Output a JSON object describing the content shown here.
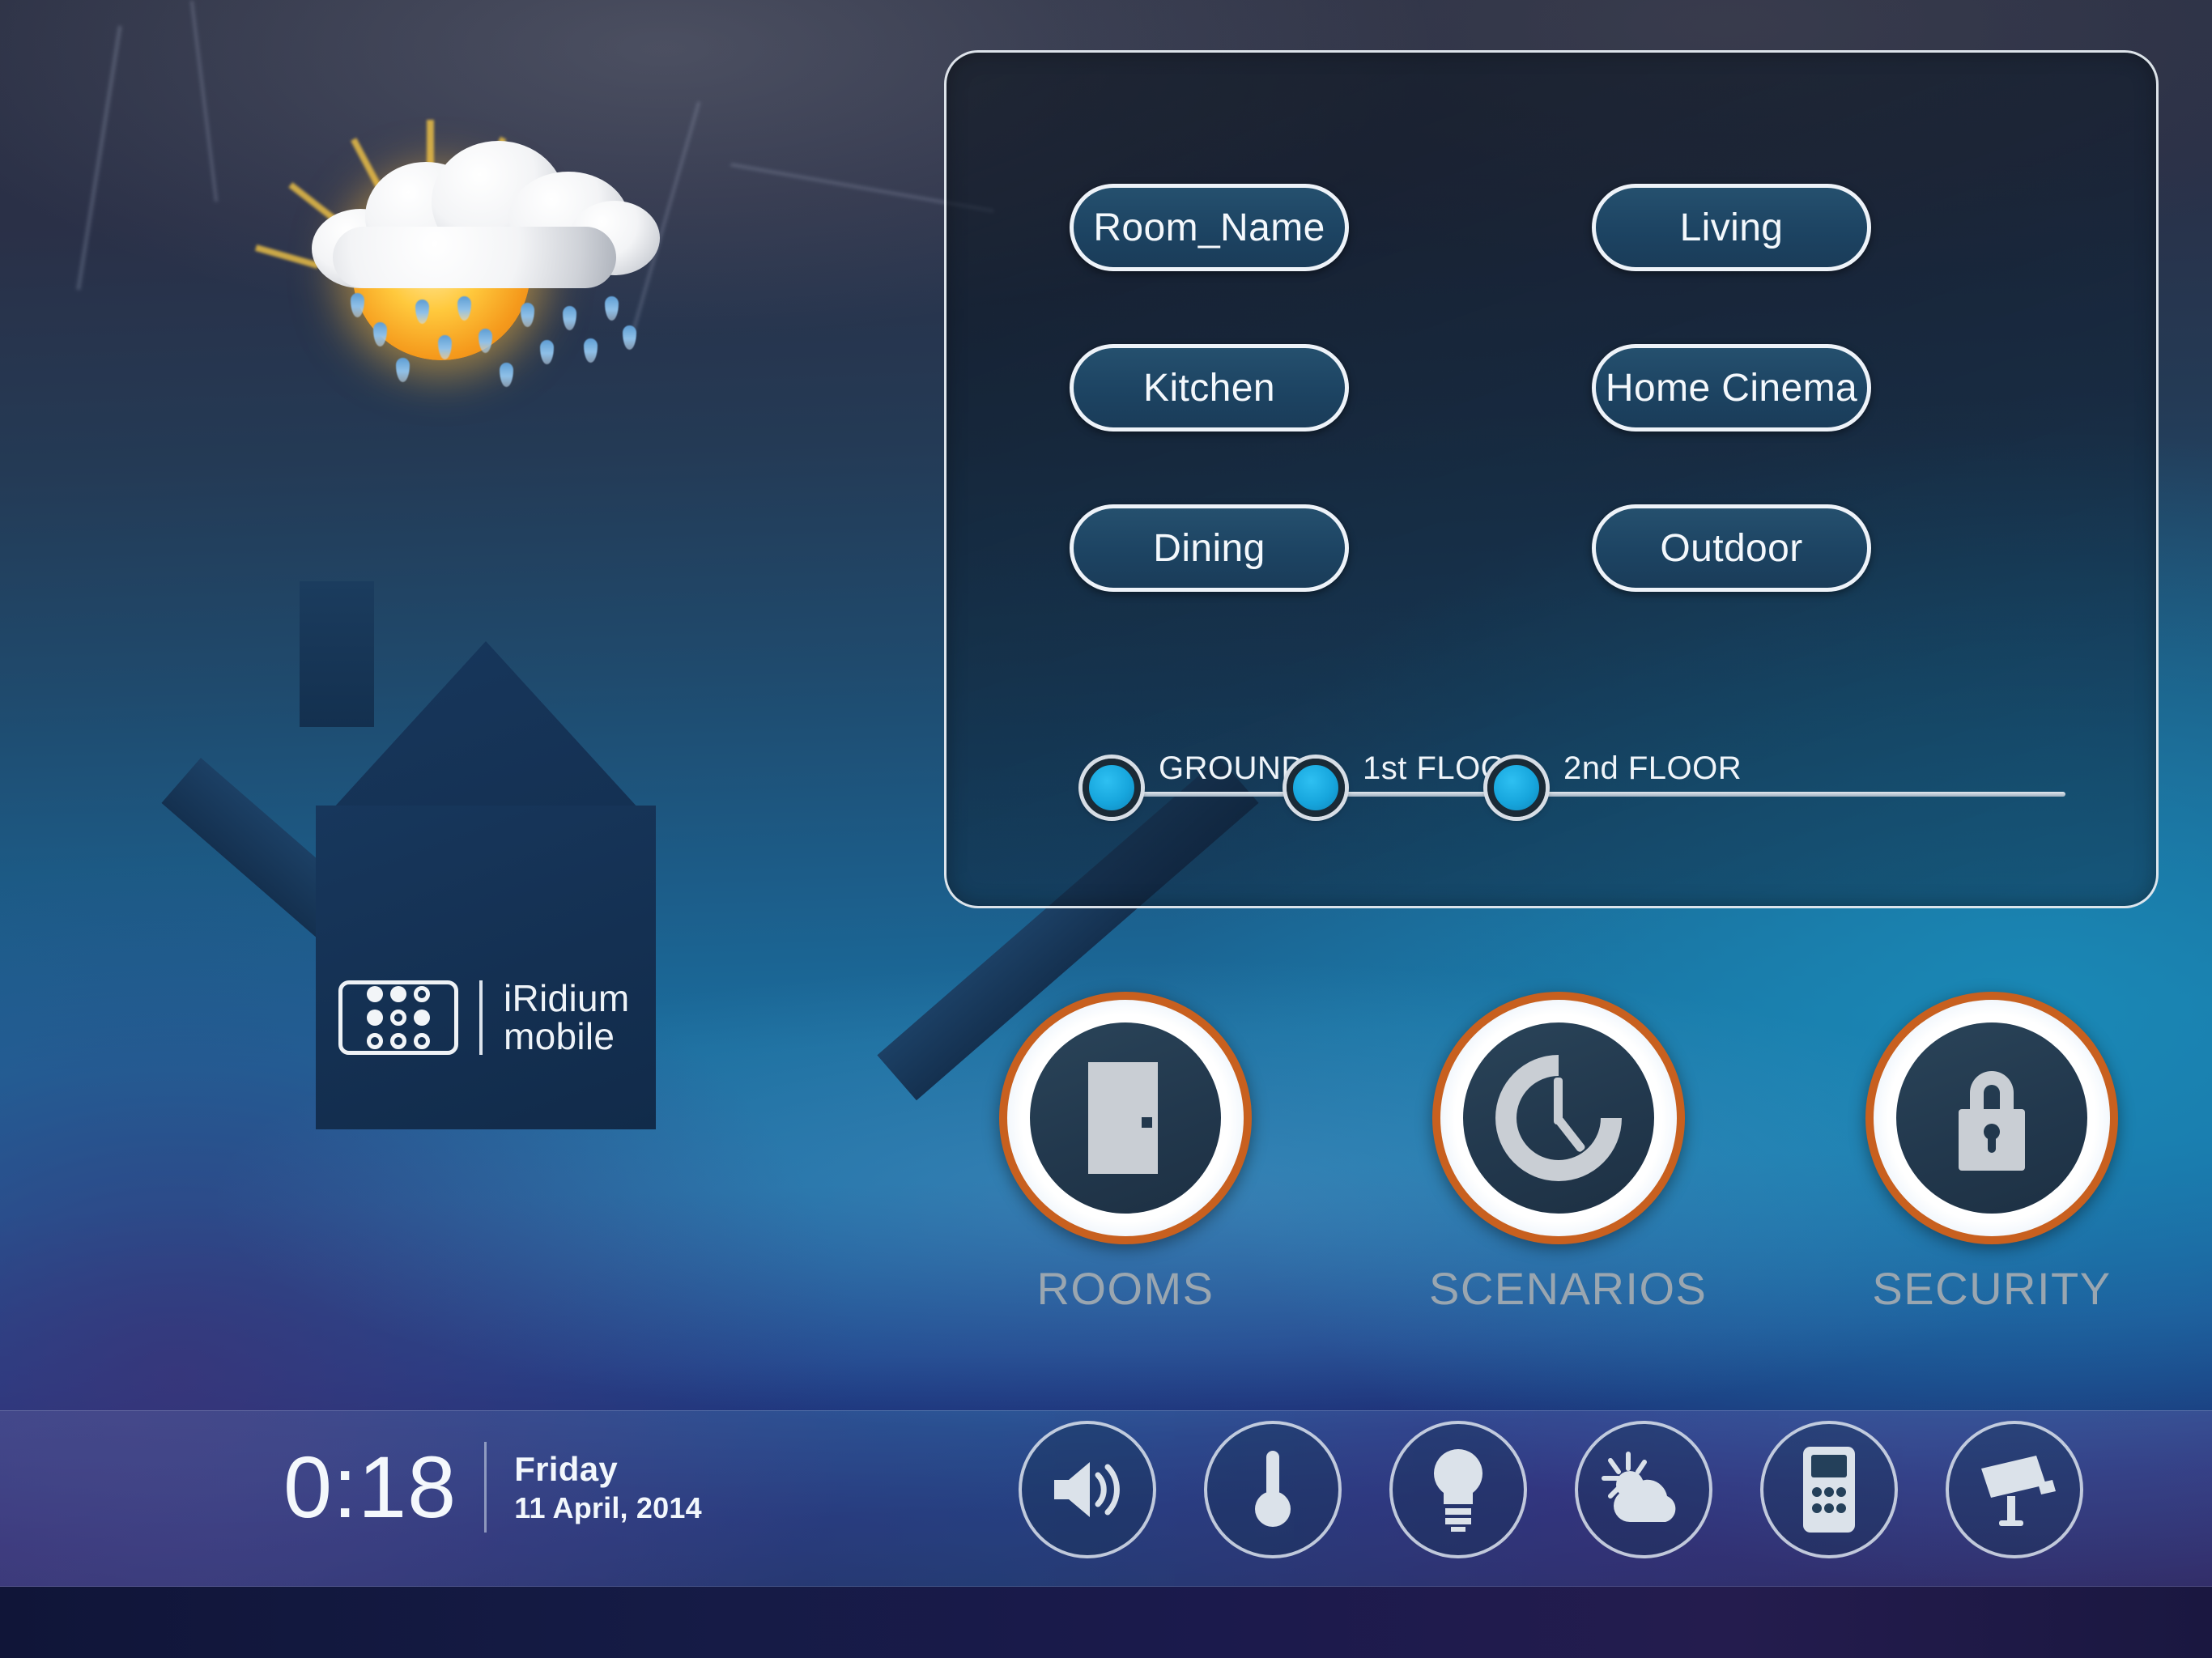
{
  "app": {
    "logo_primary": "iRidium",
    "logo_secondary": "mobile",
    "logo_icon": "keypad-grid-icon"
  },
  "weather": {
    "icon": "sun-behind-rain-cloud-icon"
  },
  "rooms_panel": {
    "buttons": [
      {
        "label": "Room_Name",
        "name": "room-button-room-name"
      },
      {
        "label": "Living",
        "name": "room-button-living"
      },
      {
        "label": "Kitchen",
        "name": "room-button-kitchen"
      },
      {
        "label": "Home Cinema",
        "name": "room-button-home-cinema"
      },
      {
        "label": "Dining",
        "name": "room-button-dining"
      },
      {
        "label": "Outdoor",
        "name": "room-button-outdoor"
      }
    ],
    "floors": [
      {
        "label": "GROUND",
        "name": "floor-selector-ground"
      },
      {
        "label": "1st FLOOR",
        "name": "floor-selector-1st"
      },
      {
        "label": "2nd FLOOR",
        "name": "floor-selector-2nd"
      }
    ]
  },
  "main_nav": [
    {
      "label": "ROOMS",
      "icon": "door-icon"
    },
    {
      "label": "SCENARIOS",
      "icon": "clock-icon"
    },
    {
      "label": "SECURITY",
      "icon": "padlock-icon"
    }
  ],
  "status_bar": {
    "time": "0:18",
    "weekday": "Friday",
    "date": "11 April, 2014",
    "toolbar": [
      {
        "label": "music",
        "icon": "speaker-icon"
      },
      {
        "label": "climate",
        "icon": "thermometer-icon"
      },
      {
        "label": "lights",
        "icon": "lightbulb-icon"
      },
      {
        "label": "weather",
        "icon": "sun-cloud-icon"
      },
      {
        "label": "intercom",
        "icon": "intercom-keypad-icon"
      },
      {
        "label": "cameras",
        "icon": "cctv-camera-icon"
      }
    ]
  },
  "colors": {
    "accent_orange": "#c8601f",
    "knob_cyan": "#17a6dd",
    "panel_border": "#eef3f9",
    "button_fill": "#1d4463",
    "core_navy": "#22384d"
  }
}
